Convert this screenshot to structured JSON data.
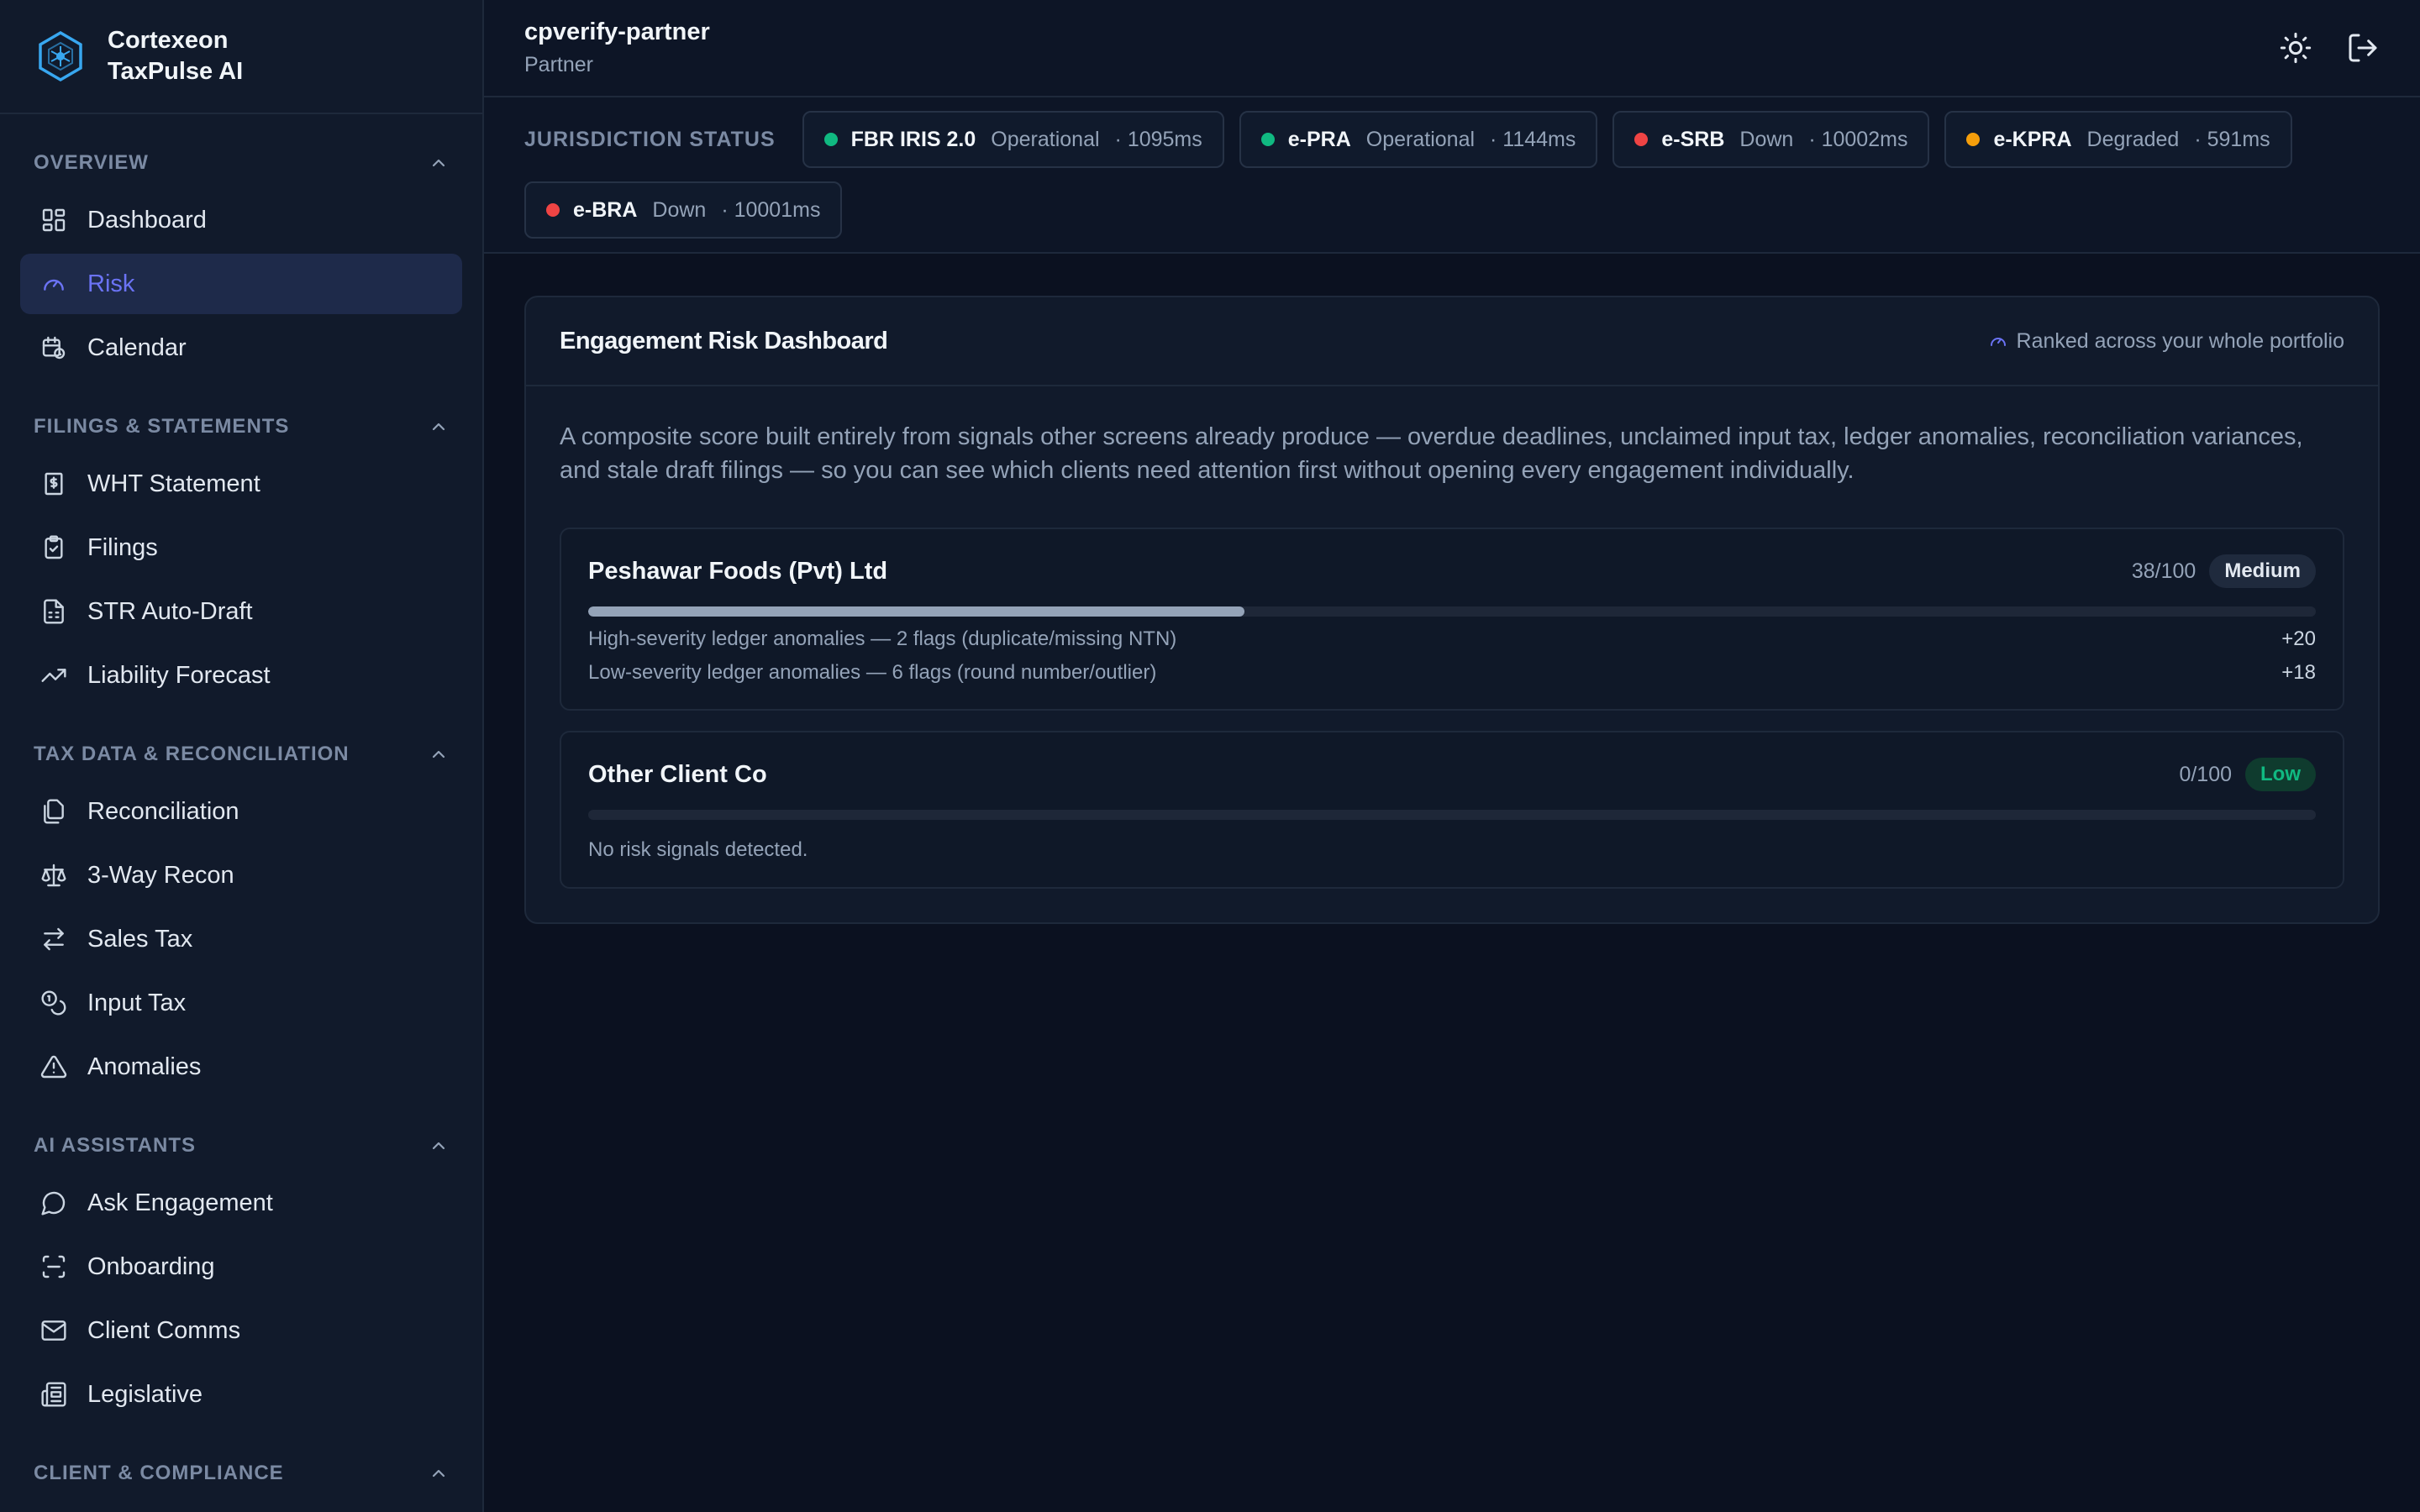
{
  "brand": {
    "line1": "Cortexeon",
    "line2": "TaxPulse AI"
  },
  "sidebar": {
    "sections": [
      {
        "title": "OVERVIEW",
        "items": [
          {
            "label": "Dashboard",
            "icon": "dashboard-icon",
            "active": false
          },
          {
            "label": "Risk",
            "icon": "gauge-icon",
            "active": true
          },
          {
            "label": "Calendar",
            "icon": "calendar-clock-icon",
            "active": false
          }
        ]
      },
      {
        "title": "FILINGS & STATEMENTS",
        "items": [
          {
            "label": "WHT Statement",
            "icon": "receipt-icon"
          },
          {
            "label": "Filings",
            "icon": "clipboard-check-icon"
          },
          {
            "label": "STR Auto-Draft",
            "icon": "file-spreadsheet-icon"
          },
          {
            "label": "Liability Forecast",
            "icon": "trending-up-icon"
          }
        ]
      },
      {
        "title": "TAX DATA & RECONCILIATION",
        "items": [
          {
            "label": "Reconciliation",
            "icon": "files-icon"
          },
          {
            "label": "3-Way Recon",
            "icon": "scale-icon"
          },
          {
            "label": "Sales Tax",
            "icon": "arrows-exchange-icon"
          },
          {
            "label": "Input Tax",
            "icon": "coins-icon"
          },
          {
            "label": "Anomalies",
            "icon": "warning-triangle-icon"
          }
        ]
      },
      {
        "title": "AI ASSISTANTS",
        "items": [
          {
            "label": "Ask Engagement",
            "icon": "chat-bubble-icon"
          },
          {
            "label": "Onboarding",
            "icon": "scan-icon"
          },
          {
            "label": "Client Comms",
            "icon": "mail-icon"
          },
          {
            "label": "Legislative",
            "icon": "newspaper-icon"
          }
        ]
      },
      {
        "title": "CLIENT & COMPLIANCE",
        "items": []
      }
    ]
  },
  "topbar": {
    "user": "cpverify-partner",
    "role": "Partner"
  },
  "jurisdiction": {
    "label": "JURISDICTION STATUS",
    "items": [
      {
        "name": "FBR IRIS 2.0",
        "state": "Operational",
        "latency": "· 1095ms",
        "color": "#10b981"
      },
      {
        "name": "e-PRA",
        "state": "Operational",
        "latency": "· 1144ms",
        "color": "#10b981"
      },
      {
        "name": "e-SRB",
        "state": "Down",
        "latency": "· 10002ms",
        "color": "#ef4444"
      },
      {
        "name": "e-KPRA",
        "state": "Degraded",
        "latency": "· 591ms",
        "color": "#f59e0b"
      },
      {
        "name": "e-BRA",
        "state": "Down",
        "latency": "· 10001ms",
        "color": "#ef4444"
      }
    ]
  },
  "card": {
    "title": "Engagement Risk Dashboard",
    "hint": "Ranked across your whole portfolio",
    "description": "A composite score built entirely from signals other screens already produce — overdue deadlines, unclaimed input tax, ledger anomalies, reconciliation variances, and stale draft filings — so you can see which clients need attention first without opening every engagement individually.",
    "clients": [
      {
        "name": "Peshawar Foods (Pvt) Ltd",
        "score": "38/100",
        "score_fraction": 0.38,
        "level": "Medium",
        "signals": [
          {
            "text": "High-severity ledger anomalies — 2 flags (duplicate/missing NTN)",
            "points": "+20"
          },
          {
            "text": "Low-severity ledger anomalies — 6 flags (round number/outlier)",
            "points": "+18"
          }
        ],
        "empty": ""
      },
      {
        "name": "Other Client Co",
        "score": "0/100",
        "score_fraction": 0,
        "level": "Low",
        "signals": [],
        "empty": "No risk signals detected."
      }
    ]
  }
}
